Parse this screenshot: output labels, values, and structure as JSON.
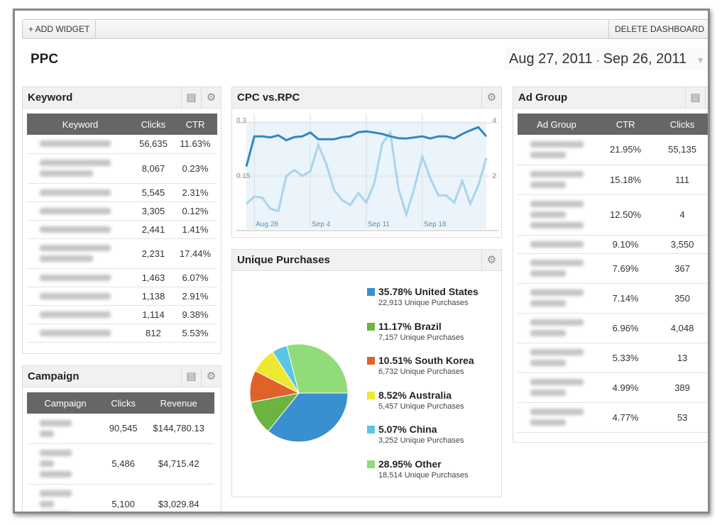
{
  "toolbar": {
    "add_widget": "+ ADD WIDGET",
    "delete_dashboard": "DELETE DASHBOARD"
  },
  "page": {
    "title": "PPC",
    "date_start": "Aug 27, 2011",
    "date_sep": "-",
    "date_end": "Sep 26, 2011"
  },
  "keyword": {
    "title": "Keyword",
    "columns": [
      "Keyword",
      "Clicks",
      "CTR"
    ],
    "rows": [
      {
        "clicks": "56,635",
        "ctr": "11.63%",
        "lines": 1
      },
      {
        "clicks": "8,067",
        "ctr": "0.23%",
        "lines": 2
      },
      {
        "clicks": "5,545",
        "ctr": "2.31%",
        "lines": 1
      },
      {
        "clicks": "3,305",
        "ctr": "0.12%",
        "lines": 1
      },
      {
        "clicks": "2,441",
        "ctr": "1.41%",
        "lines": 1
      },
      {
        "clicks": "2,231",
        "ctr": "17.44%",
        "lines": 2
      },
      {
        "clicks": "1,463",
        "ctr": "6.07%",
        "lines": 1
      },
      {
        "clicks": "1,138",
        "ctr": "2.91%",
        "lines": 1
      },
      {
        "clicks": "1,114",
        "ctr": "9.38%",
        "lines": 1
      },
      {
        "clicks": "812",
        "ctr": "5.53%",
        "lines": 1
      }
    ]
  },
  "campaign": {
    "title": "Campaign",
    "columns": [
      "Campaign",
      "Clicks",
      "Revenue"
    ],
    "rows": [
      {
        "clicks": "90,545",
        "revenue": "$144,780.13",
        "lines": 2
      },
      {
        "clicks": "5,486",
        "revenue": "$4,715.42",
        "lines": 3
      },
      {
        "clicks": "5,100",
        "revenue": "$3,029.84",
        "lines": 3
      }
    ]
  },
  "adgroup": {
    "title": "Ad Group",
    "columns": [
      "Ad Group",
      "CTR",
      "Clicks"
    ],
    "rows": [
      {
        "ctr": "21.95%",
        "clicks": "55,135",
        "lines": 2
      },
      {
        "ctr": "15.18%",
        "clicks": "111",
        "lines": 2
      },
      {
        "ctr": "12.50%",
        "clicks": "4",
        "lines": 3
      },
      {
        "ctr": "9.10%",
        "clicks": "3,550",
        "lines": 1
      },
      {
        "ctr": "7.69%",
        "clicks": "367",
        "lines": 2
      },
      {
        "ctr": "7.14%",
        "clicks": "350",
        "lines": 2
      },
      {
        "ctr": "6.96%",
        "clicks": "4,048",
        "lines": 2
      },
      {
        "ctr": "5.33%",
        "clicks": "13",
        "lines": 2
      },
      {
        "ctr": "4.99%",
        "clicks": "389",
        "lines": 2
      },
      {
        "ctr": "4.77%",
        "clicks": "53",
        "lines": 2
      }
    ]
  },
  "chart_data": [
    {
      "type": "line",
      "title": "CPC vs.RPC",
      "x_ticks": [
        "Aug 28",
        "Sep 4",
        "Sep 11",
        "Sep 18"
      ],
      "x_start": "Aug 27",
      "x_end": "Sep 26",
      "y_left_ticks": [
        "0.3",
        "0.15"
      ],
      "y_left_range": [
        0,
        0.3
      ],
      "y_right_ticks": [
        "4",
        "2"
      ],
      "y_right_range": [
        0,
        4
      ],
      "grid": true,
      "series": [
        {
          "axis": "left",
          "color": "#2f87c4",
          "values": [
            0.177,
            0.262,
            0.262,
            0.259,
            0.265,
            0.251,
            0.26,
            0.262,
            0.273,
            0.254,
            0.254,
            0.254,
            0.26,
            0.262,
            0.274,
            0.276,
            0.273,
            0.269,
            0.262,
            0.257,
            0.256,
            0.259,
            0.262,
            0.256,
            0.262,
            0.262,
            0.256,
            0.269,
            0.279,
            0.288,
            0.262
          ]
        },
        {
          "axis": "right",
          "color": "#a9d4ec",
          "values": [
            0.95,
            1.23,
            1.18,
            0.77,
            0.68,
            2.0,
            2.23,
            2.0,
            2.18,
            3.18,
            2.45,
            1.45,
            1.09,
            0.91,
            1.36,
            1.0,
            1.73,
            3.23,
            3.64,
            1.55,
            0.55,
            1.55,
            2.73,
            1.91,
            1.27,
            1.27,
            1.0,
            1.82,
            0.95,
            1.64,
            2.68
          ]
        }
      ]
    },
    {
      "type": "pie",
      "title": "Unique Purchases",
      "slices": [
        {
          "pct": "35.78%",
          "label": "United States",
          "value": 35.78,
          "sub": "22,913 Unique Purchases",
          "color": "#3a8fcf"
        },
        {
          "pct": "11.17%",
          "label": "Brazil",
          "value": 11.17,
          "sub": "7,157 Unique Purchases",
          "color": "#6db33f"
        },
        {
          "pct": "10.51%",
          "label": "South Korea",
          "value": 10.51,
          "sub": "6,732 Unique Purchases",
          "color": "#e0622a"
        },
        {
          "pct": "8.52%",
          "label": "Australia",
          "value": 8.52,
          "sub": "5,457 Unique Purchases",
          "color": "#eee830"
        },
        {
          "pct": "5.07%",
          "label": "China",
          "value": 5.07,
          "sub": "3,252 Unique Purchases",
          "color": "#5bc5e6"
        },
        {
          "pct": "28.95%",
          "label": "Other",
          "value": 28.95,
          "sub": "18,514 Unique Purchases",
          "color": "#8fdc78"
        }
      ]
    }
  ]
}
